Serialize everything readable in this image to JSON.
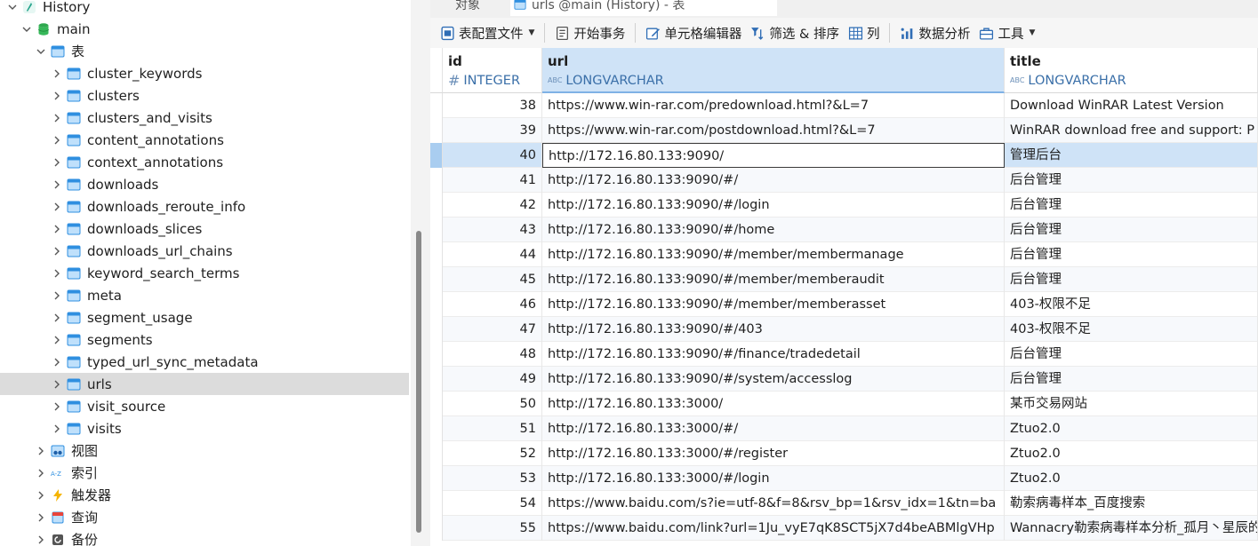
{
  "tree": {
    "root": "History",
    "schema": "main",
    "tables_group": "表",
    "tables": [
      "cluster_keywords",
      "clusters",
      "clusters_and_visits",
      "content_annotations",
      "context_annotations",
      "downloads",
      "downloads_reroute_info",
      "downloads_slices",
      "downloads_url_chains",
      "keyword_search_terms",
      "meta",
      "segment_usage",
      "segments",
      "typed_url_sync_metadata",
      "urls",
      "visit_source",
      "visits"
    ],
    "selected_table": "urls",
    "groups": [
      "视图",
      "索引",
      "触发器",
      "查询",
      "备份"
    ]
  },
  "tabs": {
    "objects": "对象",
    "active": "urls @main (History) - 表"
  },
  "toolbar": {
    "table_config": "表配置文件",
    "begin_transaction": "开始事务",
    "cell_editor": "单元格编辑器",
    "filter_sort": "筛选 & 排序",
    "columns": "列",
    "data_analysis": "数据分析",
    "tools": "工具"
  },
  "grid": {
    "columns": [
      {
        "name": "id",
        "type": "INTEGER",
        "type_icon": "#"
      },
      {
        "name": "url",
        "type": "LONGVARCHAR",
        "type_icon": "ABC"
      },
      {
        "name": "title",
        "type": "LONGVARCHAR",
        "type_icon": "ABC"
      }
    ],
    "rows": [
      {
        "id": "38",
        "url": "https://www.win-rar.com/predownload.html?&L=7",
        "title": "Download WinRAR Latest Version"
      },
      {
        "id": "39",
        "url": "https://www.win-rar.com/postdownload.html?&L=7",
        "title": "WinRAR download free and support: P"
      },
      {
        "id": "40",
        "url": "http://172.16.80.133:9090/",
        "title": "管理后台"
      },
      {
        "id": "41",
        "url": "http://172.16.80.133:9090/#/",
        "title": "后台管理"
      },
      {
        "id": "42",
        "url": "http://172.16.80.133:9090/#/login",
        "title": "后台管理"
      },
      {
        "id": "43",
        "url": "http://172.16.80.133:9090/#/home",
        "title": "后台管理"
      },
      {
        "id": "44",
        "url": "http://172.16.80.133:9090/#/member/membermanage",
        "title": "后台管理"
      },
      {
        "id": "45",
        "url": "http://172.16.80.133:9090/#/member/memberaudit",
        "title": "后台管理"
      },
      {
        "id": "46",
        "url": "http://172.16.80.133:9090/#/member/memberasset",
        "title": "403-权限不足"
      },
      {
        "id": "47",
        "url": "http://172.16.80.133:9090/#/403",
        "title": "403-权限不足"
      },
      {
        "id": "48",
        "url": "http://172.16.80.133:9090/#/finance/tradedetail",
        "title": "后台管理"
      },
      {
        "id": "49",
        "url": "http://172.16.80.133:9090/#/system/accesslog",
        "title": "后台管理"
      },
      {
        "id": "50",
        "url": "http://172.16.80.133:3000/",
        "title": "某币交易网站"
      },
      {
        "id": "51",
        "url": "http://172.16.80.133:3000/#/",
        "title": "Ztuo2.0"
      },
      {
        "id": "52",
        "url": "http://172.16.80.133:3000/#/register",
        "title": "Ztuo2.0"
      },
      {
        "id": "53",
        "url": "http://172.16.80.133:3000/#/login",
        "title": "Ztuo2.0"
      },
      {
        "id": "54",
        "url": "https://www.baidu.com/s?ie=utf-8&f=8&rsv_bp=1&rsv_idx=1&tn=ba",
        "title": "勒索病毒样本_百度搜索"
      },
      {
        "id": "55",
        "url": "https://www.baidu.com/link?url=1Ju_vyE7qK8SCT5jX7d4beABMlgVHp",
        "title": "Wannacry勒索病毒样本分析_孤月丶星辰的"
      }
    ],
    "selected_row_id": "40"
  },
  "colors": {
    "selection": "#cfe3f7",
    "tree_selection": "#dcdcdc",
    "table_icon": "#2f8fe0",
    "db_icon": "#2fa84f"
  }
}
